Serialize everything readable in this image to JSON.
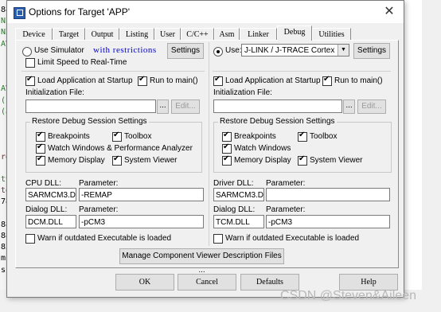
{
  "editor": {
    "lines": [
      "883",
      "N1",
      "N2",
      "AV8",
      "",
      "",
      "",
      "AV8",
      "(",
      "(a",
      "",
      "",
      "",
      "ref",
      "",
      "tva",
      "ten",
      "788",
      "",
      "883",
      "883",
      "83C",
      "ms",
      "s"
    ]
  },
  "dialog": {
    "title": "Options for Target 'APP'",
    "close_glyph": "✕",
    "tabs": [
      "Device",
      "Target",
      "Output",
      "Listing",
      "User",
      "C/C++",
      "Asm",
      "Linker",
      "Debug",
      "Utilities"
    ],
    "active_tab": "Debug"
  },
  "left": {
    "use_simulator": "Use Simulator",
    "with_restrictions": "with restrictions",
    "settings": "Settings",
    "limit_speed": "Limit Speed to Real-Time",
    "load_app": "Load Application at Startup",
    "run_to_main": "Run to main()",
    "init_file": "Initialization File:",
    "browse": "...",
    "edit": "Edit...",
    "restore_group": "Restore Debug Session Settings",
    "breakpoints": "Breakpoints",
    "toolbox": "Toolbox",
    "watch": "Watch Windows & Performance Analyzer",
    "memory": "Memory Display",
    "system_viewer": "System Viewer",
    "cpu_dll_label": "CPU DLL:",
    "cpu_param_label": "Parameter:",
    "cpu_dll": "SARMCM3.DLL",
    "cpu_param": "-REMAP",
    "dialog_dll_label": "Dialog DLL:",
    "dialog_param_label": "Parameter:",
    "dialog_dll": "DCM.DLL",
    "dialog_param": "-pCM3",
    "warn": "Warn if outdated Executable is loaded"
  },
  "right": {
    "use": "Use:",
    "debugger": "J-LINK / J-TRACE Cortex",
    "settings": "Settings",
    "load_app": "Load Application at Startup",
    "run_to_main": "Run to main()",
    "init_file": "Initialization File:",
    "browse": "...",
    "edit": "Edit...",
    "restore_group": "Restore Debug Session Settings",
    "breakpoints": "Breakpoints",
    "toolbox": "Toolbox",
    "watch": "Watch Windows",
    "memory": "Memory Display",
    "system_viewer": "System Viewer",
    "driver_dll_label": "Driver DLL:",
    "driver_param_label": "Parameter:",
    "driver_dll": "SARMCM3.DLL",
    "driver_param": "",
    "dialog_dll_label": "Dialog DLL:",
    "dialog_param_label": "Parameter:",
    "dialog_dll": "TCM.DLL",
    "dialog_param": "-pCM3",
    "warn": "Warn if outdated Executable is loaded"
  },
  "manage_button": "Manage Component Viewer Description Files ...",
  "footer": {
    "ok": "OK",
    "cancel": "Cancel",
    "defaults": "Defaults",
    "help": "Help"
  },
  "watermark": "CSDN @Steven&Aileen"
}
